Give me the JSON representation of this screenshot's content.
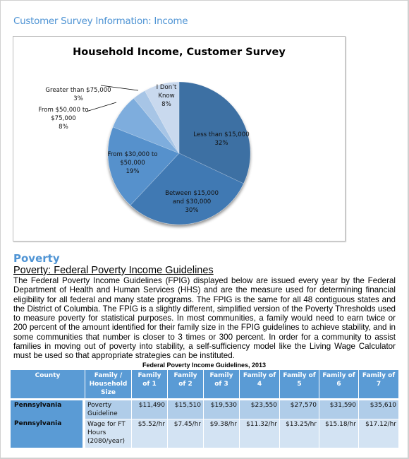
{
  "section_title": "Customer Survey Information: Income",
  "chart_data": {
    "type": "pie",
    "title": "Household Income, Customer Survey",
    "start_angle_deg": 90,
    "direction": "clockwise",
    "slices": [
      {
        "label": "Less than $15,000",
        "label_lines": [
          "Less than $15,000",
          "32%"
        ],
        "value": 32,
        "color": "#3e6fa3"
      },
      {
        "label": "Between $15,000 and $30,000",
        "label_lines": [
          "Between $15,000",
          "and $30,000",
          "30%"
        ],
        "value": 30,
        "color": "#4179b3"
      },
      {
        "label": "From $30,000 to $50,000",
        "label_lines": [
          "From $30,000 to",
          "$50,000",
          "19%"
        ],
        "value": 19,
        "color": "#5691cc"
      },
      {
        "label": "From $50,000 to $75,000",
        "label_lines": [
          "From $50,000 to",
          "$75,000",
          "8%"
        ],
        "value": 8,
        "color": "#7eaddd"
      },
      {
        "label": "Greater than $75,000",
        "label_lines": [
          "Greater than $75,000",
          "3%"
        ],
        "value": 3,
        "color": "#a7c5e6"
      },
      {
        "label": "I Don't Know",
        "label_lines": [
          "I Don’t",
          "Know",
          "8%"
        ],
        "value": 8,
        "color": "#c9d9ee"
      }
    ]
  },
  "poverty": {
    "heading": "Poverty",
    "subheading": "Poverty:  Federal Poverty Income Guidelines",
    "paragraph": "The Federal Poverty Income Guidelines (FPIG) displayed below are issued every year by the Federal Department of Health and Human Services (HHS) and are the measure used for determining financial eligibility for all federal and many state programs. The FPIG is the same for all 48 contiguous states and the District of Columbia. The FPIG is a slightly different, simplified version of the Poverty Thresholds used to measure poverty for statistical purposes. In most communities, a family would need to earn twice or 200 percent of the amount identified for their family size in the FPIG guidelines to achieve stability, and in some communities that number is closer to 3 times or 300 percent. In order for a community to assist families in moving out of poverty into stability, a self-sufficiency model like the Living Wage Calculator must be used so that appropriate strategies can be instituted."
  },
  "table": {
    "caption": "Federal Poverty Income Guidelines, 2013",
    "headers": [
      "County",
      "Family / Household Size",
      "Family of 1",
      "Family of 2",
      "Family of 3",
      "Family of 4",
      "Family of 5",
      "Family of 6",
      "Family of 7"
    ],
    "rows": [
      {
        "county": "Pennsylvania",
        "label": "Poverty Guideline",
        "values": [
          "$11,490",
          "$15,510",
          "$19,530",
          "$23,550",
          "$27,570",
          "$31,590",
          "$35,610"
        ]
      },
      {
        "county": "Pennsylvania",
        "label": "Wage for FT Hours (2080/year)",
        "values": [
          "$5.52/hr",
          "$7.45/hr",
          "$9.38/hr",
          "$11.32/hr",
          "$13.25/hr",
          "$15.18/hr",
          "$17.12/hr"
        ]
      }
    ]
  }
}
